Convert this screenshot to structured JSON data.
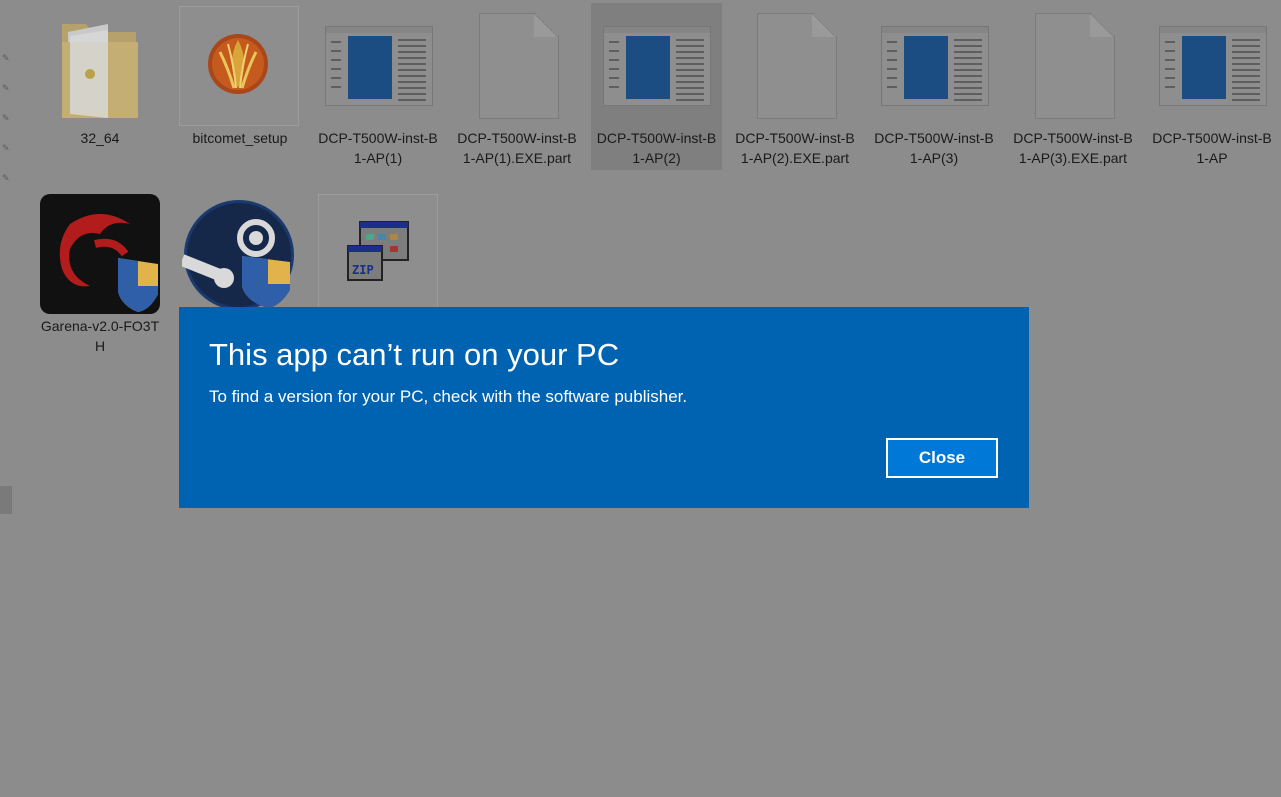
{
  "files": [
    {
      "name": "32_64",
      "kind": "folder-icon"
    },
    {
      "name": "bitcomet_setup",
      "kind": "bitcomet-icon"
    },
    {
      "name": "DCP-T500W-inst-B1-AP(1)",
      "kind": "window-thumbnail-icon"
    },
    {
      "name": "DCP-T500W-inst-B1-AP(1).EXE.part",
      "kind": "blank-file-icon"
    },
    {
      "name": "DCP-T500W-inst-B1-AP(2)",
      "kind": "window-thumbnail-icon",
      "selected": true
    },
    {
      "name": "DCP-T500W-inst-B1-AP(2).EXE.part",
      "kind": "blank-file-icon"
    },
    {
      "name": "DCP-T500W-inst-B1-AP(3)",
      "kind": "window-thumbnail-icon"
    },
    {
      "name": "DCP-T500W-inst-B1-AP(3).EXE.part",
      "kind": "blank-file-icon"
    },
    {
      "name": "DCP-T500W-inst-B1-AP",
      "kind": "window-thumbnail-icon"
    },
    {
      "name": "Garena-v2.0-FO3TH",
      "kind": "garena-icon"
    },
    {
      "name": "",
      "kind": "steam-icon"
    },
    {
      "name": "",
      "kind": "zip-installer-icon"
    }
  ],
  "dialog": {
    "title": "This app can’t run on your PC",
    "message": "To find a version for your PC, check with the software publisher.",
    "close_label": "Close",
    "background": "#0063b1",
    "button_background": "#0078d7"
  }
}
